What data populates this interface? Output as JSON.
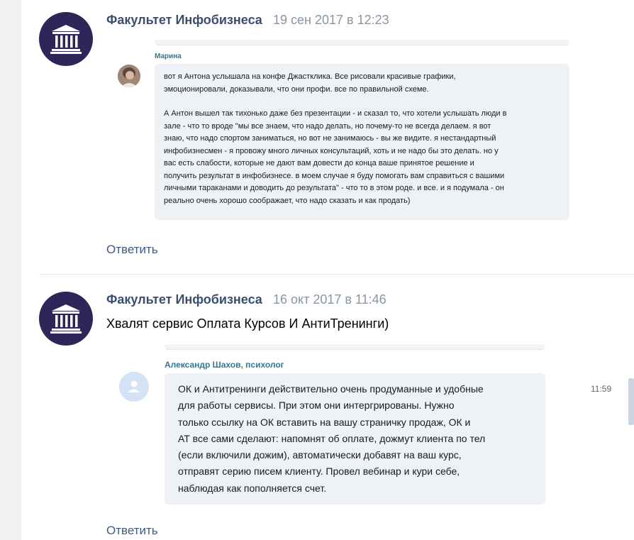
{
  "post1": {
    "author": "Факультет Инфобизнеса",
    "date": "19 сен 2017 в 12:23",
    "screenshot": {
      "sender": "Марина",
      "paragraph1": "вот я Антона услышала на конфе Джастклика. Все рисовали красивые графики,\nэмоционировали, доказывали, что они профи. все по правильной схеме.",
      "paragraph2": "А Антон вышел так тихонько даже без презентации - и сказал то, что хотели услышать люди в\nзале - что то вроде \"мы все знаем, что надо делать, но почему-то не всегда делаем. я вот\nзнаю, что надо спортом заниматься, но вот не занимаюсь - вы же видите. я нестандартный\nинфобизнесмен - я провожу много личных консультаций, хоть и не надо бы это делать. но у\nвас есть слабости, которые не дают вам довести до конца ваше  принятое решение и\nполучить результат в инфобизнесе. в моем случае я буду помогать вам справиться с вашими\nличными тараканами и доводить до результата\" - что то в этом роде. и все. и я подумала - он\nреально очень хорошо соображает, что надо сказать и как продать)"
    },
    "reply_label": "Ответить"
  },
  "post2": {
    "author": "Факультет Инфобизнеса",
    "date": "16 окт 2017 в 11:46",
    "text": "Хвалят сервис Оплата Курсов И АнтиТренинги)",
    "screenshot": {
      "sender": "Александр Шахов, психолог",
      "message": "ОК и Антитренинги действительно очень продуманные и удобные\nдля работы сервисы. При этом они интергрированы. Нужно\nтолько ссылку на ОК вставить на вашу страничку продаж, ОК и\nАТ все сами сделают: напомнят об оплате, дожмут клиента по тел\n(если включили дожим), автоматически добавят на ваш курс,\nотправят серию писем клиенту. Провел вебинар и кури себе,\nнаблюдая как пополняется счет.",
      "time": "11:59"
    },
    "reply_label": "Ответить"
  },
  "colors": {
    "avatar_bg": "#2e2559",
    "author": "#3b4e6e",
    "date": "#8a95a3",
    "link": "#3d5a83",
    "sender": "#2e7a94",
    "bubble": "#eef1f6"
  },
  "icons": {
    "community_avatar": "building-columns-icon",
    "default_user_avatar": "user-silhouette-icon"
  }
}
